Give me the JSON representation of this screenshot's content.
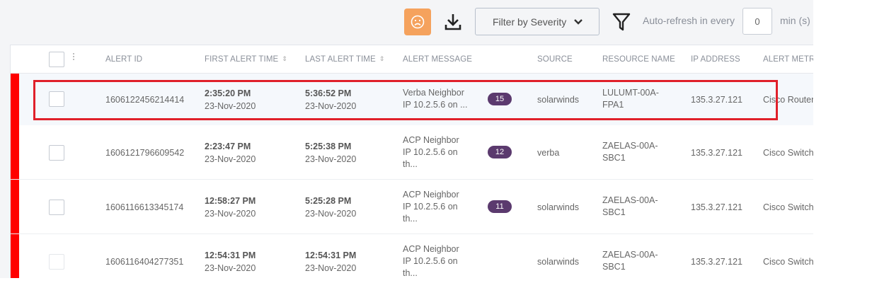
{
  "toolbar": {
    "emoji_icon": "sad-face-icon",
    "download_icon": "download-icon",
    "filter_label": "Filter by Severity",
    "funnel_icon": "funnel-icon",
    "refresh_label": "Auto-refresh in every",
    "refresh_value": "0",
    "refresh_unit": "min (s)"
  },
  "table": {
    "columns": [
      {
        "label": "ALERT ID",
        "sortable": false
      },
      {
        "label": "FIRST ALERT TIME",
        "sortable": true
      },
      {
        "label": "LAST ALERT TIME",
        "sortable": true
      },
      {
        "label": "ALERT MESSAGE",
        "sortable": false
      },
      {
        "label": "SOURCE",
        "sortable": false
      },
      {
        "label": "RESOURCE NAME",
        "sortable": false
      },
      {
        "label": "IP ADDRESS",
        "sortable": false
      },
      {
        "label": "ALERT METRIC",
        "sortable": false
      }
    ],
    "rows": [
      {
        "alert_id": "1606122456214414",
        "first_time": "2:35:20 PM",
        "first_date": "23-Nov-2020",
        "last_time": "5:36:52 PM",
        "last_date": "23-Nov-2020",
        "message_lines": [
          "Verba Neighbor",
          "IP 10.2.5.6 on ..."
        ],
        "count": "15",
        "source": "solarwinds",
        "resource_lines": [
          "LULUMT-00A-",
          "FPA1"
        ],
        "ip": "135.3.27.121",
        "metric": "Cisco Router"
      },
      {
        "alert_id": "1606121796609542",
        "first_time": "2:23:47 PM",
        "first_date": "23-Nov-2020",
        "last_time": "5:25:38 PM",
        "last_date": "23-Nov-2020",
        "message_lines": [
          "ACP Neighbor",
          "IP 10.2.5.6 on",
          "th..."
        ],
        "count": "12",
        "source": "verba",
        "resource_lines": [
          "ZAELAS-00A-",
          "SBC1"
        ],
        "ip": "135.3.27.121",
        "metric": "Cisco Switch"
      },
      {
        "alert_id": "1606116613345174",
        "first_time": "12:58:27 PM",
        "first_date": "23-Nov-2020",
        "last_time": "5:25:28 PM",
        "last_date": "23-Nov-2020",
        "message_lines": [
          "ACP Neighbor",
          "IP 10.2.5.6 on",
          "th..."
        ],
        "count": "11",
        "source": "solarwinds",
        "resource_lines": [
          "ZAELAS-00A-",
          "SBC1"
        ],
        "ip": "135.3.27.121",
        "metric": "Cisco Switch"
      },
      {
        "alert_id": "1606116404277351",
        "first_time": "12:54:31 PM",
        "first_date": "23-Nov-2020",
        "last_time": "12:54:31 PM",
        "last_date": "23-Nov-2020",
        "message_lines": [
          "ACP Neighbor",
          "IP 10.2.5.6 on",
          "th..."
        ],
        "count": "",
        "source": "solarwinds",
        "resource_lines": [
          "ZAELAS-00A-",
          "SBC1"
        ],
        "ip": "135.3.27.121",
        "metric": "Cisco Switch"
      }
    ]
  },
  "colors": {
    "severity": "#ff0000",
    "badge": "#5b3a6e",
    "emoji_button": "#f5a25d",
    "highlight": "#e0202a"
  }
}
